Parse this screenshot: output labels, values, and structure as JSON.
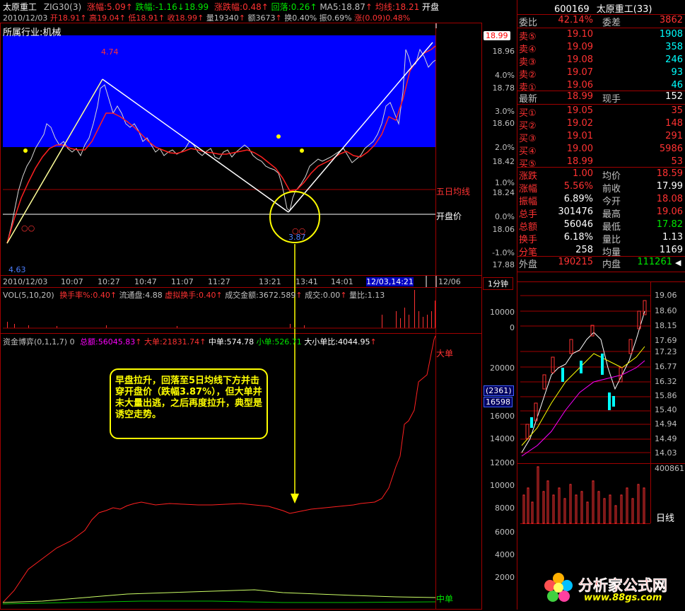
{
  "header": {
    "line1": {
      "name": "太原重工",
      "zig": "ZIG30(3)",
      "zf_label": "涨幅:",
      "zf_val": "5.09",
      "zf_arr": "↑",
      "die_label": "跌幅:",
      "die_val": "-1.16",
      "die_arr": "↓",
      "price": "18.99",
      "zdf_label": "涨跌幅:",
      "zdf_val": "0.48",
      "zdf_arr": "↑",
      "hl_label": "回落:",
      "hl_val": "0.26",
      "hl_arr": "↑",
      "ma5": "MA5:18.87",
      "ma5_arr": "↑",
      "jx_label": "均线:",
      "jx_val": "18.21",
      "kp": "开盘"
    },
    "line2": {
      "date": "2010/12/03",
      "open": "开18.91",
      "arr1": "↑",
      "high": "高19.04",
      "arr2": "↑",
      "low": "低18.91",
      "arr3": "↑",
      "close": "收18.99",
      "arr4": "↑",
      "vol": "量19340",
      "arr5": "↑",
      "amt": "额3673",
      "arr6": "↑",
      "turn": "换0.40%",
      "zhen": "振0.69%",
      "zhang": "涨(0.09)0.48%"
    },
    "industry": "所属行业:机械"
  },
  "price_chart": {
    "peak_label": "4.74",
    "low_label": "3.87",
    "start_label": "4.63",
    "five_day_label": "五日均线",
    "open_label": "开盘价",
    "right_axis": [
      "18.96",
      "18.78",
      "18.60",
      "18.42",
      "18.24",
      "18.06",
      "17.88"
    ],
    "pct_axis": [
      "4.0%",
      "3.0%",
      "2.0%",
      "1.0%",
      "0.0%",
      "-1.0%"
    ],
    "price_tag": "18.99"
  },
  "time_axis": [
    "2010/12/03",
    "10:07",
    "10:27",
    "10:47",
    "11:07",
    "11:27",
    "13:21",
    "13:41",
    "14:01",
    "12/03,14:21",
    "12/06"
  ],
  "period_tab": "1分钟",
  "vol_header": {
    "name": "VOL(5,10,20)",
    "turn": "换手率%:0.40",
    "turn_arr": "↑",
    "float": "流通盘:4.88",
    "vturn": "虚拟换手:0.40",
    "vturn_arr": "↑",
    "amt": "成交金额:3672.589",
    "amt_arr": "↑",
    "deal": "成交:0.00",
    "deal_arr": "↑",
    "ratio": "量比:1.13"
  },
  "vol_axis": [
    "10000",
    "0"
  ],
  "fund_header": {
    "name": "资金博弈(0,1,1,7) 0",
    "total": "总额:56045.83",
    "total_arr": "↑",
    "big": "大单:21831.74",
    "big_arr": "↑",
    "mid": "中单:574.78",
    "small": "小单:526.71",
    "bs": "大小单比:4044.95",
    "bs_arr": "↑"
  },
  "fund_axis": [
    "20000",
    "16000",
    "14000",
    "12000",
    "10000",
    "8000",
    "6000",
    "4000",
    "2000"
  ],
  "fund_tags": {
    "a": "(2361)",
    "b": "16598"
  },
  "fund_labels": {
    "big": "大单",
    "mid": "中单"
  },
  "annotation": "早盘拉升，回落至5日均线下方并击穿开盘价（跌幅3.87%），但大单并未大量出逃，之后再度拉升，典型是诱空走势。",
  "quote": {
    "code": "600169",
    "name": "太原重工(33)",
    "weibi_l": "委比",
    "weibi_v": "42.14%",
    "weicha_l": "委差",
    "weicha_v": "3862",
    "sells": [
      {
        "l": "卖⑤",
        "p": "19.10",
        "v": "1908"
      },
      {
        "l": "卖④",
        "p": "19.09",
        "v": "358"
      },
      {
        "l": "卖③",
        "p": "19.08",
        "v": "246"
      },
      {
        "l": "卖②",
        "p": "19.07",
        "v": "93"
      },
      {
        "l": "卖①",
        "p": "19.06",
        "v": "46"
      }
    ],
    "last_l": "最新",
    "last_v": "18.99",
    "xs_l": "现手",
    "xs_v": "152",
    "buys": [
      {
        "l": "买①",
        "p": "19.05",
        "v": "35"
      },
      {
        "l": "买②",
        "p": "19.02",
        "v": "148"
      },
      {
        "l": "买③",
        "p": "19.01",
        "v": "291"
      },
      {
        "l": "买④",
        "p": "19.00",
        "v": "5986"
      },
      {
        "l": "买⑤",
        "p": "18.99",
        "v": "53"
      }
    ],
    "stats": [
      {
        "l": "涨跌",
        "v": "1.00",
        "l2": "均价",
        "v2": "18.59"
      },
      {
        "l": "涨幅",
        "v": "5.56%",
        "l2": "前收",
        "v2": "17.99"
      },
      {
        "l": "振幅",
        "v": "6.89%",
        "l2": "今开",
        "v2": "18.08"
      },
      {
        "l": "总手",
        "v": "301476",
        "l2": "最高",
        "v2": "19.06"
      },
      {
        "l": "总额",
        "v": "56046",
        "l2": "最低",
        "v2": "17.82"
      },
      {
        "l": "换手",
        "v": "6.18%",
        "l2": "量比",
        "v2": "1.13"
      },
      {
        "l": "分笔",
        "v": "258",
        "l2": "均量",
        "v2": "1169"
      }
    ],
    "wp_l": "外盘",
    "wp_v": "190215",
    "np_l": "内盘",
    "np_v": "111261"
  },
  "kline_axis": [
    "19.06",
    "18.60",
    "18.15",
    "17.69",
    "17.23",
    "16.77",
    "16.32",
    "15.86",
    "15.40",
    "14.94",
    "14.49",
    "14.03"
  ],
  "kline_vol": "400861",
  "kline_tab": "日线",
  "logo": {
    "cn": "分析家公式网",
    "url": "www.88gs.com"
  }
}
